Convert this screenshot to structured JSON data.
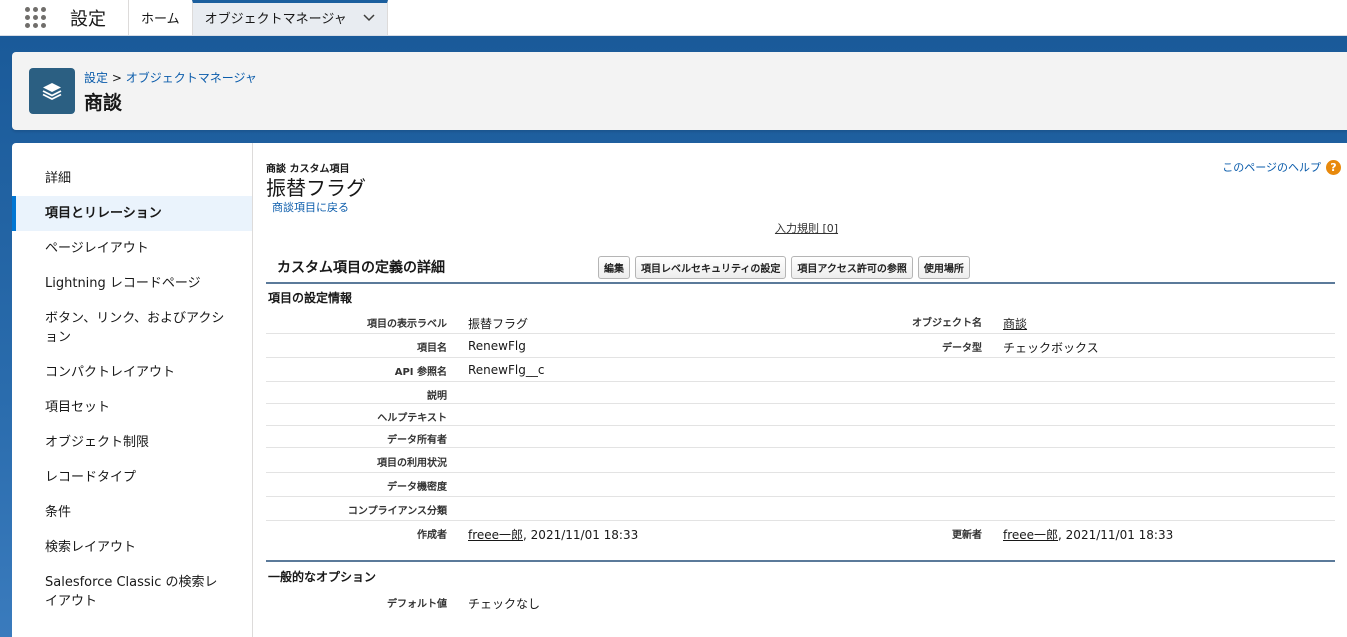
{
  "topnav": {
    "app_name": "設定",
    "tabs": [
      "ホーム",
      "オブジェクトマネージャ"
    ]
  },
  "header": {
    "breadcrumb_root": "設定",
    "breadcrumb_sep": ">",
    "breadcrumb_leaf": "オブジェクトマネージャ",
    "title": "商談"
  },
  "sidebar": {
    "items": [
      "詳細",
      "項目とリレーション",
      "ページレイアウト",
      "Lightning レコードページ",
      "ボタン、リンク、およびアクション",
      "コンパクトレイアウト",
      "項目セット",
      "オブジェクト制限",
      "レコードタイプ",
      "条件",
      "検索レイアウト",
      "Salesforce Classic の検索レイアウト"
    ],
    "active_index": 1
  },
  "detail": {
    "kicker": "商談 カスタム項目",
    "title": "振替フラグ",
    "back_link": "商談項目に戻る",
    "help_link": "このページのヘルプ",
    "validation_rules": "入力規則 [0]",
    "section_title": "カスタム項目の定義の詳細",
    "buttons": [
      "編集",
      "項目レベルセキュリティの設定",
      "項目アクセス許可の参照",
      "使用場所"
    ],
    "settings_heading": "項目の設定情報",
    "options_heading": "一般的なオプション",
    "rows": [
      {
        "l1": "項目の表示ラベル",
        "v1": "振替フラグ",
        "l2": "オブジェクト名",
        "v2": "商談"
      },
      {
        "l1": "項目名",
        "v1": "RenewFlg",
        "l2": "データ型",
        "v2": "チェックボックス"
      },
      {
        "l1": "API 参照名",
        "v1": "RenewFlg__c",
        "l2": "",
        "v2": ""
      },
      {
        "l1": "説明",
        "v1": "",
        "l2": "",
        "v2": ""
      },
      {
        "l1": "ヘルプテキスト",
        "v1": "",
        "l2": "",
        "v2": ""
      },
      {
        "l1": "データ所有者",
        "v1": "",
        "l2": "",
        "v2": ""
      },
      {
        "l1": "項目の利用状況",
        "v1": "",
        "l2": "",
        "v2": ""
      },
      {
        "l1": "データ機密度",
        "v1": "",
        "l2": "",
        "v2": ""
      },
      {
        "l1": "コンプライアンス分類",
        "v1": "",
        "l2": "",
        "v2": ""
      },
      {
        "l1": "作成者",
        "v1_user": "freee一郎",
        "v1_date": ", 2021/11/01 18:33",
        "l2": "更新者",
        "v2_user": "freee一郎",
        "v2_date": ", 2021/11/01 18:33"
      }
    ],
    "default_label": "デフォルト値",
    "default_value": "チェックなし"
  }
}
